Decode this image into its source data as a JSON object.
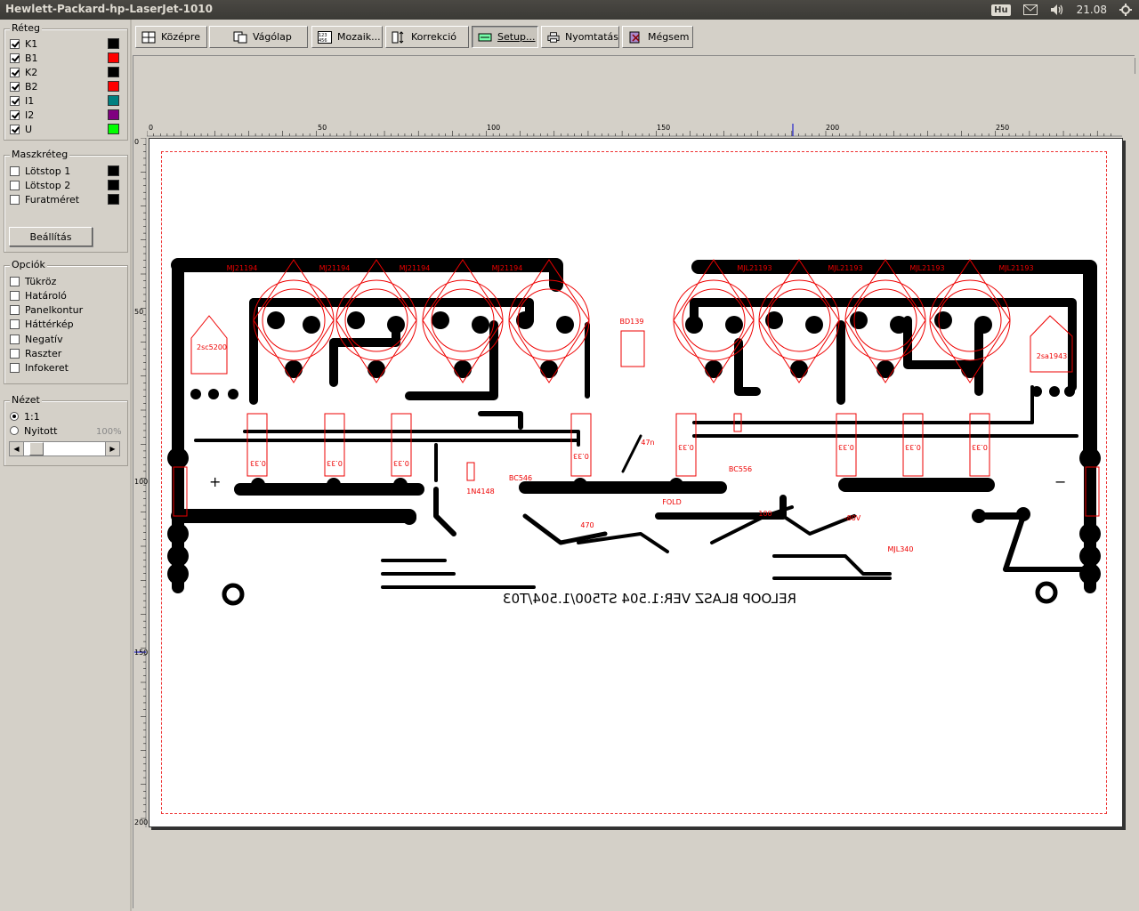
{
  "window": {
    "title": "Hewlett-Packard-hp-LaserJet-1010"
  },
  "tray": {
    "keyboard": "Hu",
    "clock": "21.08",
    "icons": [
      "mail-icon",
      "volume-icon",
      "settings-gear-icon"
    ]
  },
  "layers": {
    "title": "Réteg",
    "items": [
      {
        "label": "K1",
        "checked": true,
        "color": "#000000"
      },
      {
        "label": "B1",
        "checked": true,
        "color": "#ff0000"
      },
      {
        "label": "K2",
        "checked": true,
        "color": "#000000"
      },
      {
        "label": "B2",
        "checked": true,
        "color": "#ff0000"
      },
      {
        "label": "I1",
        "checked": true,
        "color": "#008080"
      },
      {
        "label": "I2",
        "checked": true,
        "color": "#800080"
      },
      {
        "label": "U",
        "checked": true,
        "color": "#00ff00"
      }
    ]
  },
  "mask": {
    "title": "Maszkréteg",
    "items": [
      {
        "label": "Lötstop 1",
        "checked": false,
        "color": "#000000"
      },
      {
        "label": "Lötstop 2",
        "checked": false,
        "color": "#000000"
      },
      {
        "label": "Furatméret",
        "checked": false,
        "color": "#000000"
      }
    ],
    "button": "Beállítás"
  },
  "options": {
    "title": "Opciók",
    "items": [
      {
        "label": "Tükröz",
        "checked": false
      },
      {
        "label": "Határoló",
        "checked": false
      },
      {
        "label": "Panelkontur",
        "checked": false
      },
      {
        "label": "Háttérkép",
        "checked": false
      },
      {
        "label": "Negatív",
        "checked": false
      },
      {
        "label": "Raszter",
        "checked": false
      },
      {
        "label": "Infokeret",
        "checked": false
      }
    ]
  },
  "view": {
    "title": "Nézet",
    "options": [
      {
        "label": "1:1",
        "selected": true
      },
      {
        "label": "Nyitott",
        "selected": false
      }
    ],
    "zoom": "100%"
  },
  "toolbar": {
    "buttons": [
      {
        "label": "Középre",
        "icon": "center-icon"
      },
      {
        "label": "Vágólap",
        "icon": "clipboard-icon"
      },
      {
        "label": "Mozaik...",
        "icon": "mosaic-icon"
      },
      {
        "label": "Korrekció",
        "icon": "correction-icon"
      },
      {
        "label": "Setup...",
        "icon": "setup-icon",
        "pressed": true
      },
      {
        "label": "Nyomtatás",
        "icon": "printer-icon"
      },
      {
        "label": "Mégsem",
        "icon": "cancel-icon"
      }
    ],
    "help": "?"
  },
  "rulers": {
    "h": [
      "0",
      "50",
      "100",
      "150",
      "200",
      "250"
    ],
    "v": [
      "0",
      "50",
      "100",
      "150",
      "200"
    ]
  },
  "pcb": {
    "bottom_text": "RELOOP BLASZ VER:1.504 ST500/1.504/T03",
    "transistor_labels_left": [
      "MJ21194",
      "MJ21194",
      "MJ21194",
      "MJ21194"
    ],
    "transistor_labels_right": [
      "MJL21193",
      "MJL21193",
      "MJL21193",
      "MJL21193"
    ],
    "driver_left": "2sc5200",
    "driver_right": "2sa1943",
    "resistor_label": "0.33",
    "plus": "+",
    "minus": "−",
    "small_labels": [
      "BD139",
      "BC546",
      "BC556",
      "1N4148",
      "470",
      "FOLD",
      "-80V",
      "MJL340",
      "100",
      "47n"
    ]
  }
}
